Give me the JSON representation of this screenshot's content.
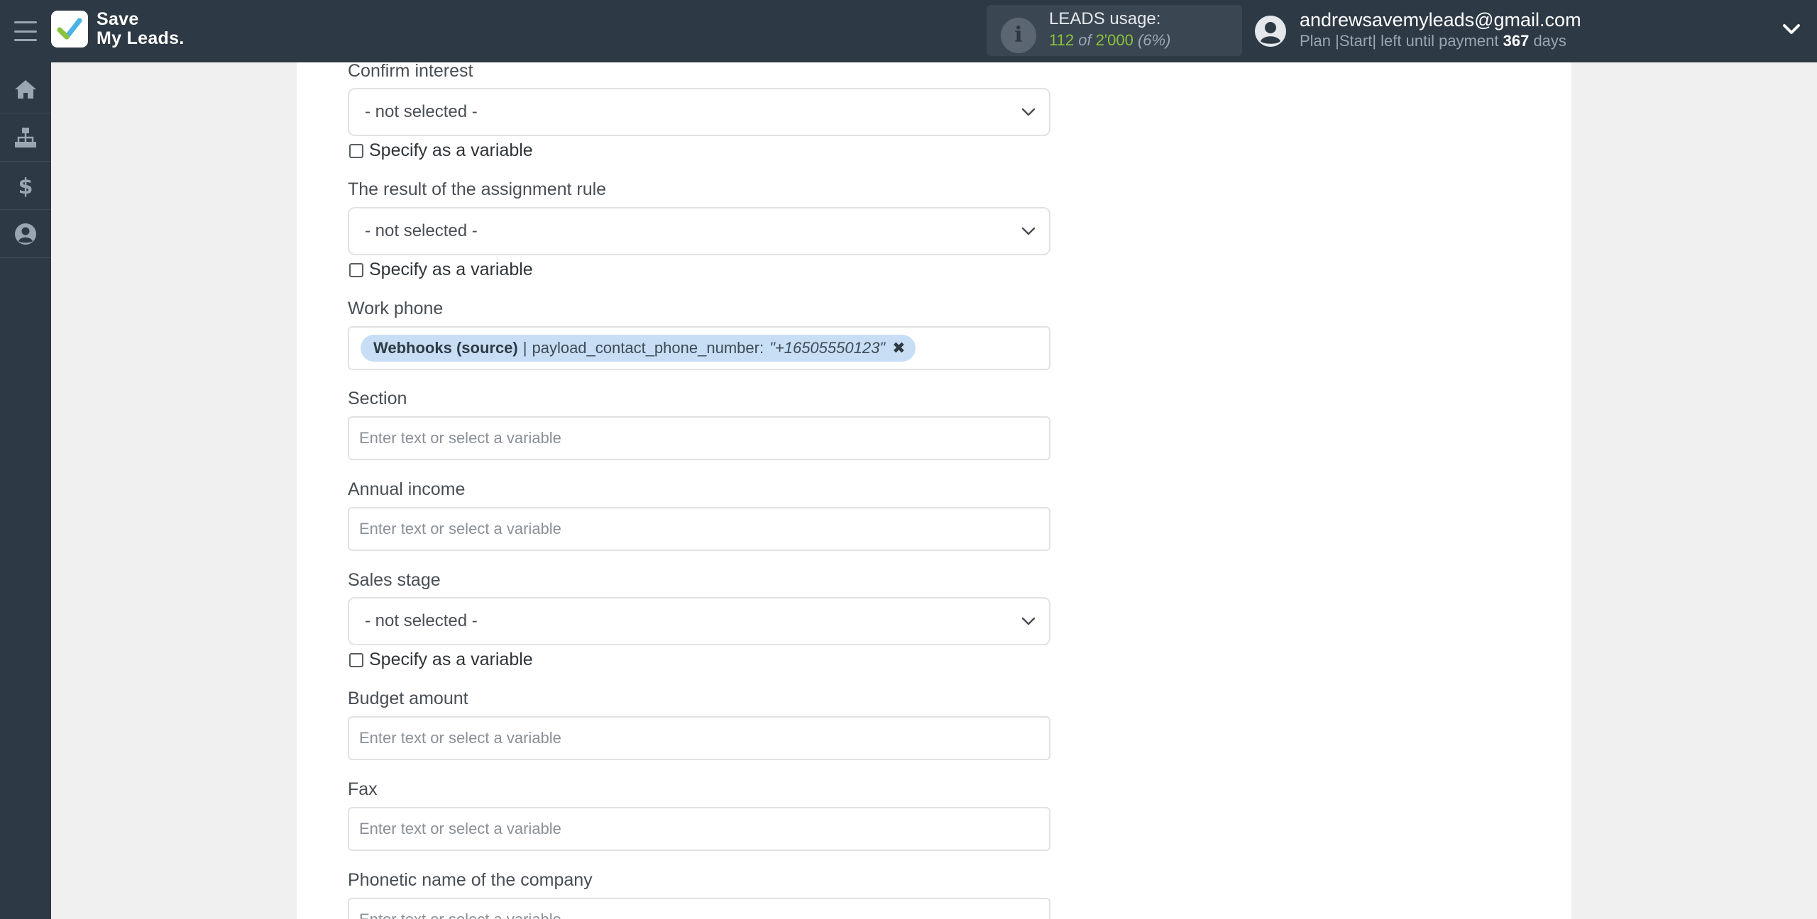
{
  "logo": {
    "line1": "Save",
    "line2": "My Leads."
  },
  "usage": {
    "title": "LEADS usage:",
    "used": "112",
    "of": "of",
    "limit": "2'000",
    "percent": "(6%)"
  },
  "account": {
    "email": "andrewsavemyleads@gmail.com",
    "plan_prefix": "Plan |Start| left until payment",
    "days": "367",
    "days_suffix": "days"
  },
  "sidebar": {
    "items": [
      {
        "name": "home",
        "icon": "home-icon"
      },
      {
        "name": "connections",
        "icon": "sitemap-icon"
      },
      {
        "name": "billing",
        "icon": "dollar-icon"
      },
      {
        "name": "profile",
        "icon": "user-circle-icon"
      }
    ]
  },
  "form": {
    "confirm_interest": {
      "label": "Confirm interest",
      "value": "- not selected -",
      "checkbox": "Specify as a variable"
    },
    "assignment_rule": {
      "label": "The result of the assignment rule",
      "value": "- not selected -",
      "checkbox": "Specify as a variable"
    },
    "work_phone": {
      "label": "Work phone",
      "tag_source": "Webhooks (source)",
      "tag_sep": "|",
      "tag_field": "payload_contact_phone_number:",
      "tag_value": "\"+16505550123\"",
      "tag_remove": "✖"
    },
    "section": {
      "label": "Section",
      "placeholder": "Enter text or select a variable"
    },
    "annual_income": {
      "label": "Annual income",
      "placeholder": "Enter text or select a variable"
    },
    "sales_stage": {
      "label": "Sales stage",
      "value": "- not selected -",
      "checkbox": "Specify as a variable"
    },
    "budget_amount": {
      "label": "Budget amount",
      "placeholder": "Enter text or select a variable"
    },
    "fax": {
      "label": "Fax",
      "placeholder": "Enter text or select a variable"
    },
    "phonetic_company": {
      "label": "Phonetic name of the company",
      "placeholder": "Enter text or select a variable"
    }
  }
}
